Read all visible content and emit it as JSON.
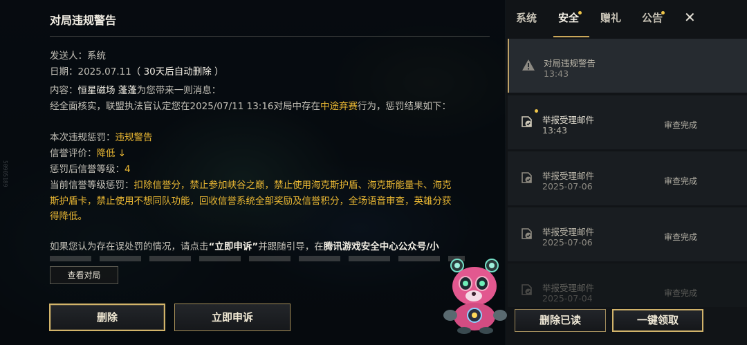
{
  "side_watermark": "50905189",
  "mail": {
    "title": "对局违规警告",
    "sender_label": "发送人：",
    "sender": "系统",
    "date_label": "日期：",
    "date": "2025.07.11",
    "date_note": "（ 30天后自动删除 ）",
    "content_label": "内容：",
    "content_from": "恒星磁场 蓬蓬",
    "content_tail": "为您带来一则消息：",
    "verdict_pre": "经全面核实，联盟执法官认定您在2025/07/11 13:16对局中存在",
    "verdict_hl": "中途弃赛",
    "verdict_post": "行为，惩罚结果如下：",
    "penalty_label": "本次违规惩罚：",
    "penalty": "违规警告",
    "credit_label": "信誉评价：",
    "credit": "降低",
    "credit_arrow": "↓",
    "level_label": "惩罚后信誉等级：",
    "level": "4",
    "current_label": "当前信誉等级惩罚：",
    "current_line1": "扣除信誉分，禁止参加峡谷之巅，禁止使用海克斯护盾、海克斯能量卡、海克",
    "current_line2": "斯护盾卡，禁止使用不想同队功能，回收信誉系统全部奖励及信誉积分，全场语音审查，英雄分获",
    "current_line3": "得降低。",
    "appeal_pre": "如果您认为存在误处罚的情况，请点击",
    "appeal_btn": "“立即申诉”",
    "appeal_mid": "并跟随引导，在",
    "appeal_bold": "腾讯游戏安全中心公众号/小",
    "view_match": "查看对局",
    "delete": "删除",
    "appeal": "立即申诉"
  },
  "tabs": [
    {
      "label": "系统",
      "dot": false
    },
    {
      "label": "安全",
      "dot": true
    },
    {
      "label": "赠礼",
      "dot": false
    },
    {
      "label": "公告",
      "dot": true
    }
  ],
  "close_icon": "✕",
  "list": [
    {
      "name": "对局违规警告",
      "time": "13:43",
      "status": "",
      "icon": "warning-icon",
      "unread": false
    },
    {
      "name": "举报受理邮件",
      "time": "13:43",
      "status": "审查完成",
      "icon": "mail-check-icon",
      "unread": true
    },
    {
      "name": "举报受理邮件",
      "time": "2025-07-06",
      "status": "审查完成",
      "icon": "mail-check-icon",
      "unread": false
    },
    {
      "name": "举报受理邮件",
      "time": "2025-07-06",
      "status": "审查完成",
      "icon": "mail-check-icon",
      "unread": false
    },
    {
      "name": "举报受理邮件",
      "time": "2025-07-04",
      "status": "审查完成",
      "icon": "mail-check-icon",
      "unread": false
    }
  ],
  "buttons": {
    "delete_read": "删除已读",
    "claim_all": "一键领取"
  },
  "colors": {
    "accent_gold": "#e9b733",
    "unread_dot": "#f0c64a",
    "border_gold": "#d1b36a"
  }
}
